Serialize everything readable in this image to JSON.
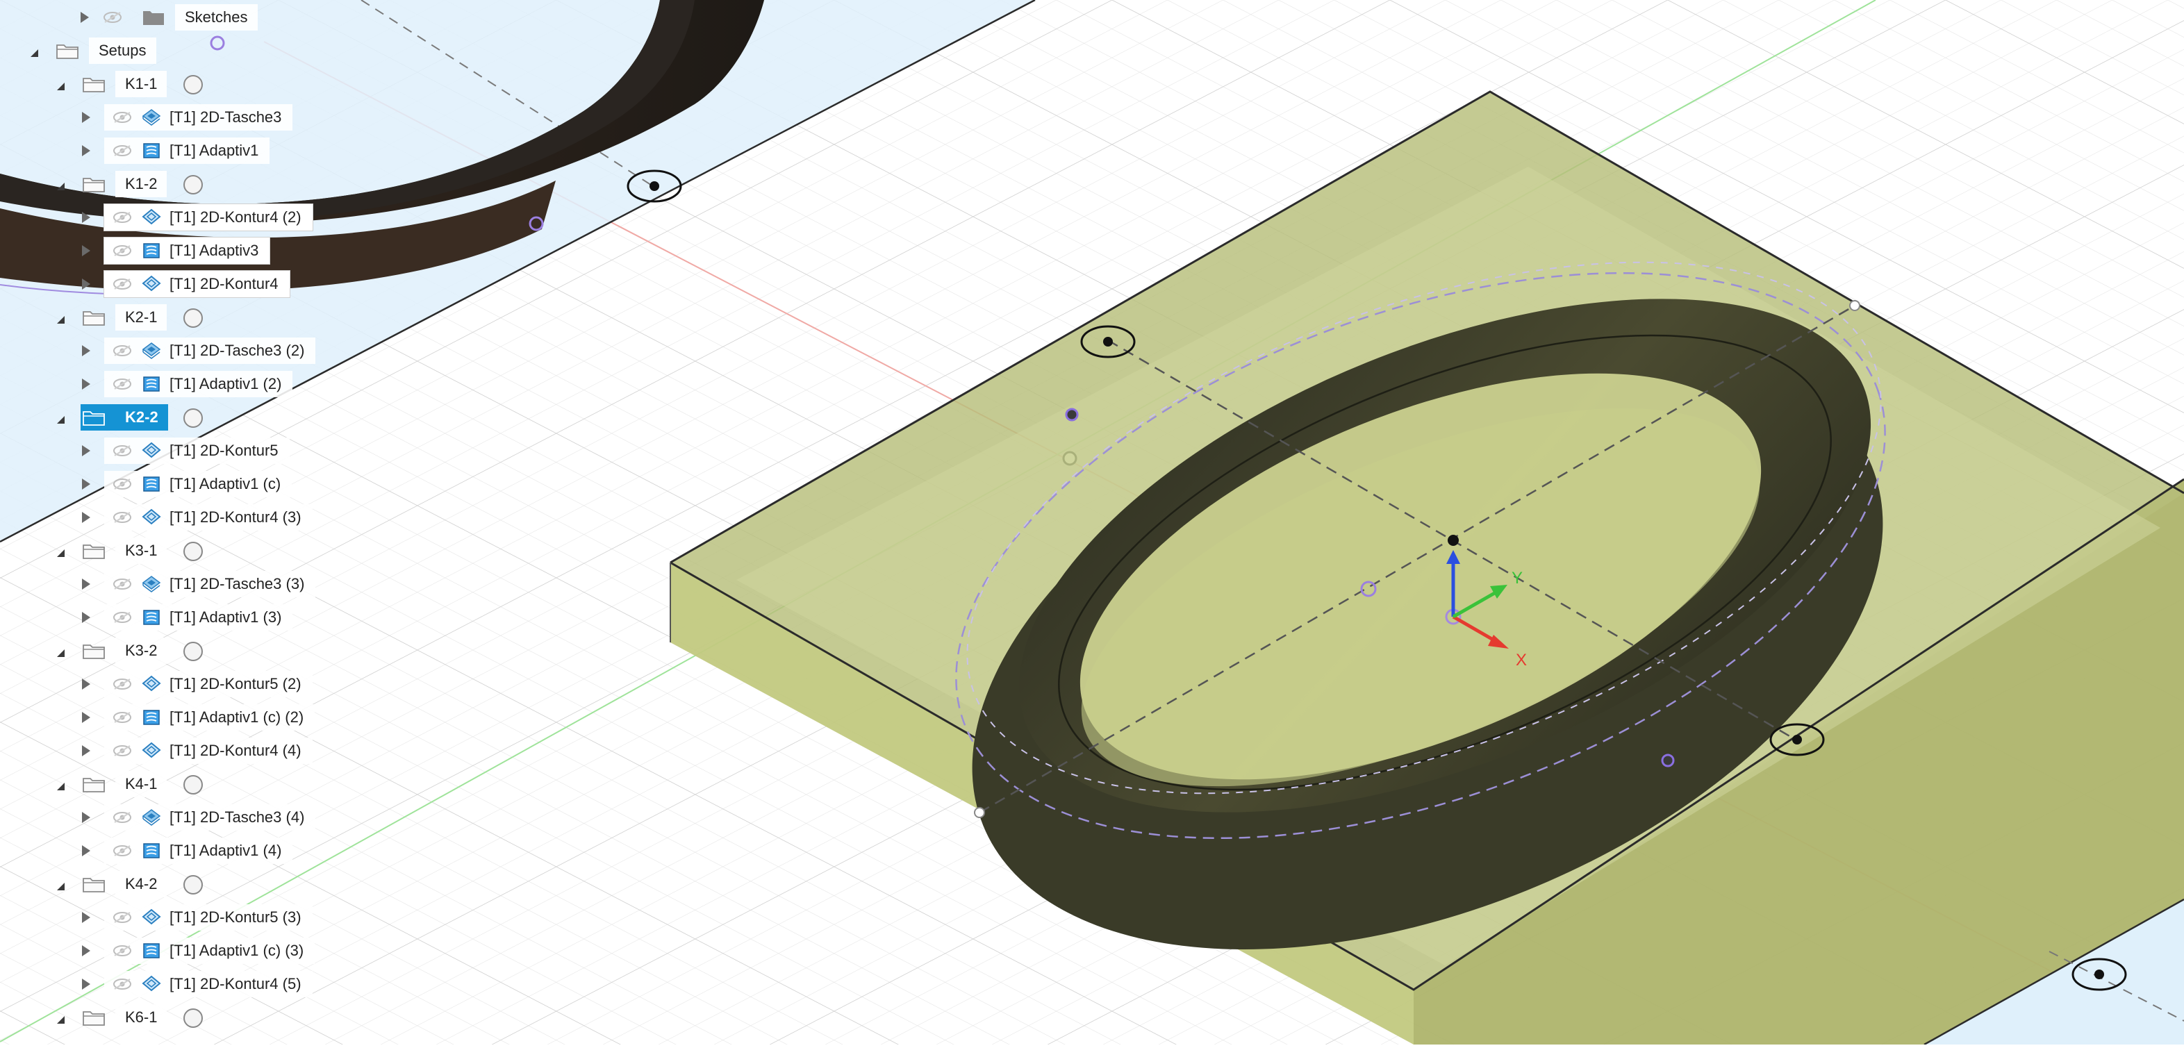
{
  "browser": {
    "sketches_label": "Sketches",
    "setups_label": "Setups",
    "setups": [
      {
        "name": "K1-1",
        "selected": false,
        "ops": [
          {
            "label": "[T1] 2D-Tasche3",
            "type": "pocket"
          },
          {
            "label": "[T1] Adaptiv1",
            "type": "adaptive"
          }
        ]
      },
      {
        "name": "K1-2",
        "selected": false,
        "ops": [
          {
            "label": "[T1] 2D-Kontur4 (2)",
            "type": "contour"
          },
          {
            "label": "[T1] Adaptiv3",
            "type": "adaptive"
          },
          {
            "label": "[T1] 2D-Kontur4",
            "type": "contour"
          }
        ]
      },
      {
        "name": "K2-1",
        "selected": false,
        "ops": [
          {
            "label": "[T1] 2D-Tasche3 (2)",
            "type": "pocket"
          },
          {
            "label": "[T1] Adaptiv1 (2)",
            "type": "adaptive"
          }
        ]
      },
      {
        "name": "K2-2",
        "selected": true,
        "ops": [
          {
            "label": "[T1] 2D-Kontur5",
            "type": "contour"
          },
          {
            "label": "[T1] Adaptiv1 (c)",
            "type": "adaptive"
          },
          {
            "label": "[T1] 2D-Kontur4 (3)",
            "type": "contour"
          }
        ]
      },
      {
        "name": "K3-1",
        "selected": false,
        "ops": [
          {
            "label": "[T1] 2D-Tasche3 (3)",
            "type": "pocket"
          },
          {
            "label": "[T1] Adaptiv1 (3)",
            "type": "adaptive"
          }
        ]
      },
      {
        "name": "K3-2",
        "selected": false,
        "ops": [
          {
            "label": "[T1] 2D-Kontur5 (2)",
            "type": "contour"
          },
          {
            "label": "[T1] Adaptiv1 (c) (2)",
            "type": "adaptive"
          },
          {
            "label": "[T1] 2D-Kontur4 (4)",
            "type": "contour"
          }
        ]
      },
      {
        "name": "K4-1",
        "selected": false,
        "ops": [
          {
            "label": "[T1] 2D-Tasche3 (4)",
            "type": "pocket"
          },
          {
            "label": "[T1] Adaptiv1 (4)",
            "type": "adaptive"
          }
        ]
      },
      {
        "name": "K4-2",
        "selected": false,
        "ops": [
          {
            "label": "[T1] 2D-Kontur5 (3)",
            "type": "contour"
          },
          {
            "label": "[T1] Adaptiv1 (c) (3)",
            "type": "adaptive"
          },
          {
            "label": "[T1] 2D-Kontur4 (5)",
            "type": "contour"
          }
        ]
      },
      {
        "name": "K6-1",
        "selected": false,
        "ops": []
      }
    ]
  },
  "triad": {
    "x_label": "X",
    "y_label": "Y",
    "x_color": "#e53a2f",
    "y_color": "#3ac23a",
    "z_color": "#2b4fe0"
  },
  "colors": {
    "selection": "#1593d4",
    "stock": "#b9c27a",
    "part": "#3e3f2c",
    "sketch_fill": "#dff0fb"
  },
  "icons": {
    "eye": "eye-icon",
    "folder": "folder-icon",
    "pocket": "pocket-2d-icon",
    "adaptive": "adaptive-icon",
    "contour": "contour-2d-icon"
  }
}
